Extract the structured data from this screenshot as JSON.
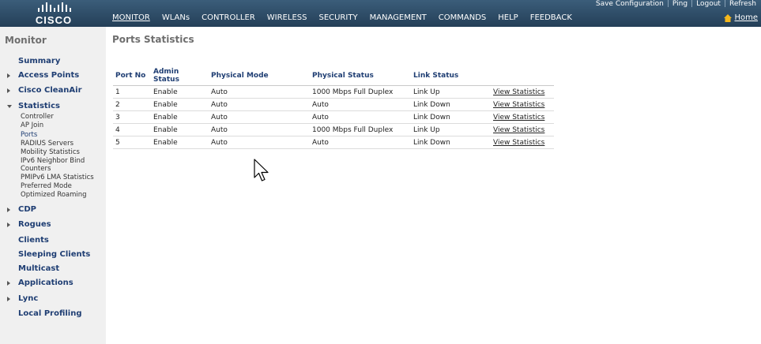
{
  "header": {
    "logo_text": "CISCO",
    "utility_links": [
      "Save Configuration",
      "Ping",
      "Logout",
      "Refresh"
    ],
    "nav": [
      "MONITOR",
      "WLANs",
      "CONTROLLER",
      "WIRELESS",
      "SECURITY",
      "MANAGEMENT",
      "COMMANDS",
      "HELP",
      "FEEDBACK"
    ],
    "active_nav": "MONITOR",
    "home_label": "Home"
  },
  "sidebar": {
    "title": "Monitor",
    "items": [
      {
        "label": "Summary",
        "arrow": "none"
      },
      {
        "label": "Access Points",
        "arrow": "right"
      },
      {
        "label": "Cisco CleanAir",
        "arrow": "right"
      },
      {
        "label": "Statistics",
        "arrow": "down"
      },
      {
        "label": "CDP",
        "arrow": "right"
      },
      {
        "label": "Rogues",
        "arrow": "right"
      },
      {
        "label": "Clients",
        "arrow": "none"
      },
      {
        "label": "Sleeping Clients",
        "arrow": "none"
      },
      {
        "label": "Multicast",
        "arrow": "none"
      },
      {
        "label": "Applications",
        "arrow": "right"
      },
      {
        "label": "Lync",
        "arrow": "right"
      },
      {
        "label": "Local Profiling",
        "arrow": "none"
      }
    ],
    "statistics_sub": [
      "Controller",
      "AP Join",
      "Ports",
      "RADIUS Servers",
      "Mobility Statistics",
      "IPv6 Neighbor Bind",
      "Counters",
      "PMIPv6 LMA Statistics",
      "Preferred Mode",
      "Optimized Roaming"
    ]
  },
  "main": {
    "title": "Ports Statistics",
    "columns": [
      "Port No",
      "Admin Status",
      "Physical Mode",
      "Physical Status",
      "Link Status",
      ""
    ],
    "rows": [
      {
        "port": "1",
        "admin": "Enable",
        "mode": "Auto",
        "phys": "1000 Mbps Full Duplex",
        "link": "Link Up",
        "action": "View Statistics"
      },
      {
        "port": "2",
        "admin": "Enable",
        "mode": "Auto",
        "phys": "Auto",
        "link": "Link Down",
        "action": "View Statistics"
      },
      {
        "port": "3",
        "admin": "Enable",
        "mode": "Auto",
        "phys": "Auto",
        "link": "Link Down",
        "action": "View Statistics"
      },
      {
        "port": "4",
        "admin": "Enable",
        "mode": "Auto",
        "phys": "1000 Mbps Full Duplex",
        "link": "Link Up",
        "action": "View Statistics"
      },
      {
        "port": "5",
        "admin": "Enable",
        "mode": "Auto",
        "phys": "Auto",
        "link": "Link Down",
        "action": "View Statistics"
      }
    ]
  },
  "colors": {
    "header_top": "#3b5d7a",
    "header_bottom": "#243f58",
    "sidebar_bg": "#f0f0f0",
    "link": "#2a4f9e",
    "label_blue": "#1f3e73"
  }
}
